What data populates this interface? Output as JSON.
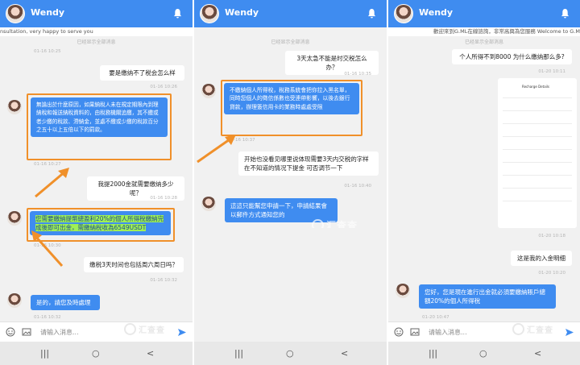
{
  "app": {
    "contact_name": "Wendy"
  },
  "panels": [
    {
      "ticker": "nsultation, very happy to serve you",
      "notice": "已经显示全部消息",
      "messages": [
        {
          "time": "01-16 10:25"
        },
        {
          "text": "要是缴纳不了税会怎么样",
          "time": "01-16 10:26"
        },
        {
          "text": "無論出於什麼原因，如果納稅人未在規定期限內到理納稅和報送納稅資料的，由稅務機關追繳，其不繳或者少繳的稅款、滯納金，並處不繳或少繳的稅款百分之五十以上五倍以下的罰款。",
          "time": "01-16 10:27"
        },
        {
          "text": "我提2000金就需要缴纳多少呢？",
          "time": "01-16 10:28"
        },
        {
          "text": "您需要繳納提幣總盈利20%的個人所得稅繳納完成後即可出金，需繳納稅收為6549USDT",
          "time": "01-16 10:30"
        },
        {
          "text": "缴税3天时间也包括周六周日吗？",
          "time": "01-16 10:32"
        },
        {
          "text": "是的，請您及時處理",
          "time": "01-16 10:32"
        }
      ],
      "input_placeholder": "请输入消息..."
    },
    {
      "notice": "已经显示全部消息",
      "messages": [
        {
          "text": "3天太急不能是时交税怎么办？"
        },
        {
          "time": "01-16 10:35"
        },
        {
          "text": "不繳納個人所得稅，稅務系統會把你拉入黑名單，同時您個人的徵信係數也受連帶影響，以後去銀行貸款，辦理簽信用卡的業務時處處受限",
          "time": "01-16 10:37"
        },
        {
          "text": "开始也没看见哪里说体现需要3天内交税的字样在不知道的情况下提金 可否调节一下",
          "time": "01-16 10:40"
        },
        {
          "text": "這這只能幫您申請一下，申請結果會以郵件方式通知您的"
        }
      ],
      "watermark": "汇查查"
    },
    {
      "ticker": "歡迎來到G.ML在線諮詢，非常高興為您服務 Welcome to G.ML",
      "notice": "已经显示全部消息",
      "messages": [
        {
          "text": "个人所得不到8000 为什么缴纳那么多?",
          "time": "01-20 10:11"
        },
        {
          "time": "01-20 10:18"
        },
        {
          "text": "这是我的入金明细",
          "time": "01-20 10:20"
        },
        {
          "text": "您好，您是現在進行出金就必須要繳納賬戶總額20%的個人所得稅",
          "time": "01-20 10:47"
        }
      ],
      "image_card": {
        "title": "Recharge Details"
      },
      "input_placeholder": "请输入消息..."
    }
  ],
  "nav": {
    "recent": "|||",
    "home": "○",
    "back": "<"
  },
  "colors": {
    "header_blue": "#3f8cf0",
    "highlight_orange": "#f0902a",
    "highlight_green": "#9ef056"
  }
}
